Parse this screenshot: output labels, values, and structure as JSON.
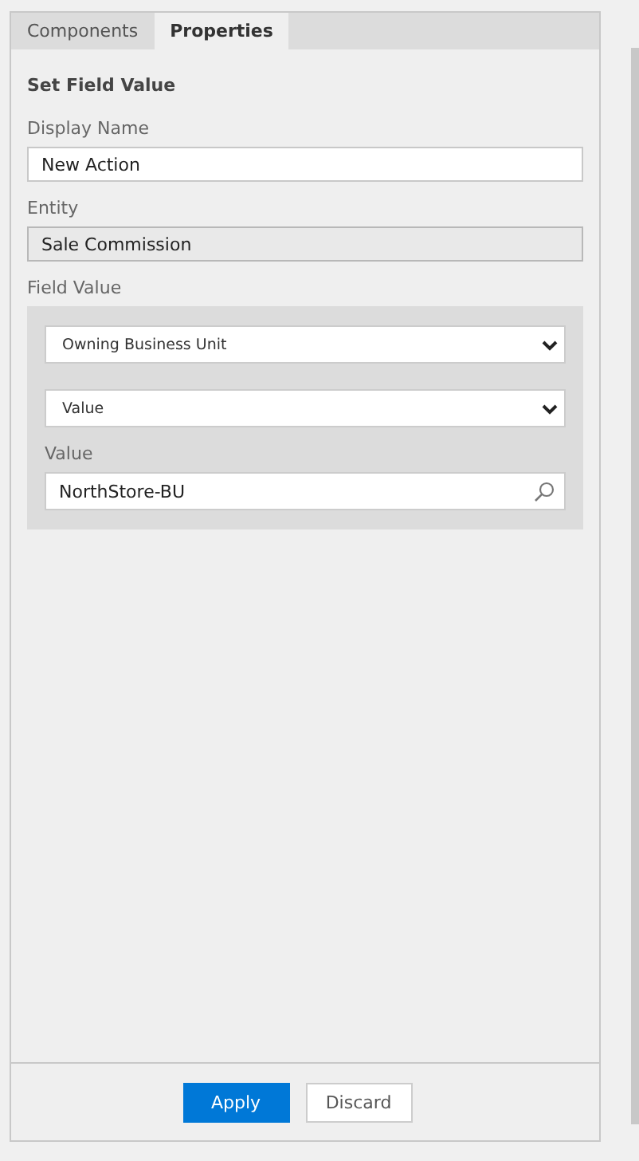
{
  "tabs": [
    {
      "label": "Components",
      "selected": false
    },
    {
      "label": "Properties",
      "selected": true
    }
  ],
  "section_title": "Set Field Value",
  "fields": [
    {
      "label": "Display Name",
      "value": "New Action",
      "readonly": false
    },
    {
      "label": "Entity",
      "value": "Sale Commission",
      "readonly": true
    }
  ],
  "field_value": {
    "label": "Field Value",
    "selects": [
      {
        "value": "Owning Business Unit"
      },
      {
        "value": "Value"
      }
    ],
    "lookup": {
      "label": "Value",
      "value": "NorthStore-BU"
    }
  },
  "buttons": [
    {
      "label": "Apply",
      "kind": "primary"
    },
    {
      "label": "Discard",
      "kind": "secondary"
    }
  ]
}
